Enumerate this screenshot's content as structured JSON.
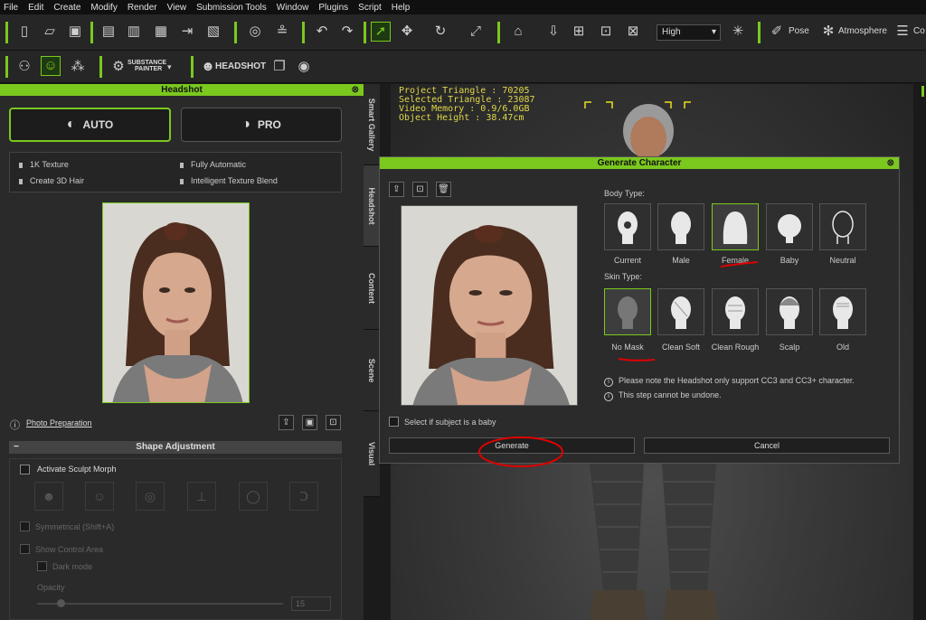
{
  "menu": [
    "File",
    "Edit",
    "Create",
    "Modify",
    "Render",
    "View",
    "Submission Tools",
    "Window",
    "Plugins",
    "Script",
    "Help"
  ],
  "toolbar": {
    "quality": "High",
    "pose_label": "Pose",
    "atmosphere_label": "Atmosphere",
    "cut_label": "Co",
    "substance_line1": "SUBSTANCE",
    "substance_line2": "PAINTER",
    "headshot_label": "HEADSHOT"
  },
  "headshot_panel": {
    "title": "Headshot",
    "auto_label": "AUTO",
    "pro_label": "PRO",
    "features": [
      "1K Texture",
      "Fully Automatic",
      "Create 3D Hair",
      "Intelligent Texture Blend"
    ],
    "photo_prep_label": "Photo Preparation",
    "shape_adjust_title": "Shape Adjustment",
    "activate_sculpt_label": "Activate Sculpt Morph",
    "symmetrical_label": "Symmetrical (Shift+A)",
    "show_control_label": "Show Control Area",
    "dark_mode_label": "Dark mode",
    "opacity_label": "Opacity",
    "opacity_value": "15"
  },
  "side_tabs": [
    "Smart Gallery",
    "Headshot",
    "Content",
    "Scene",
    "Visual"
  ],
  "viewport_stats": [
    "Project Triangle : 70205",
    "Selected Triangle : 23087",
    "Video Memory : 0.9/6.0GB",
    "Object Height : 38.47cm"
  ],
  "dialog": {
    "title": "Generate Character",
    "body_type_label": "Body Type:",
    "body_types": [
      "Current",
      "Male",
      "Female",
      "Baby",
      "Neutral"
    ],
    "skin_type_label": "Skin Type:",
    "skin_types": [
      "No Mask",
      "Clean Soft",
      "Clean Rough",
      "Scalp",
      "Old"
    ],
    "note1": "Please note the Headshot only support CC3 and CC3+ character.",
    "note2": "This step cannot be undone.",
    "baby_checkbox_label": "Select if subject is a baby",
    "generate_label": "Generate",
    "cancel_label": "Cancel"
  },
  "colors": {
    "accent": "#7bc81e",
    "annotation": "#e00000"
  }
}
